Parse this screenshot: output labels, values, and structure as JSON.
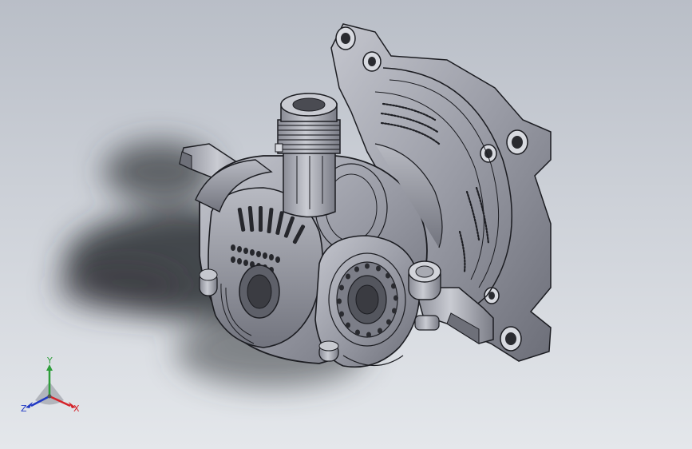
{
  "triad": {
    "x_label": "X",
    "y_label": "Y",
    "z_label": "Z"
  },
  "colors": {
    "background_top": "#b9bec7",
    "background_bottom": "#e4e7eb",
    "part_body": "#9a9ca6",
    "part_edge": "#1c1d22",
    "x_axis": "#d4232a",
    "y_axis": "#2e9e3a",
    "z_axis": "#2139c4"
  },
  "icons": [
    "coordinate-triad-icon"
  ]
}
